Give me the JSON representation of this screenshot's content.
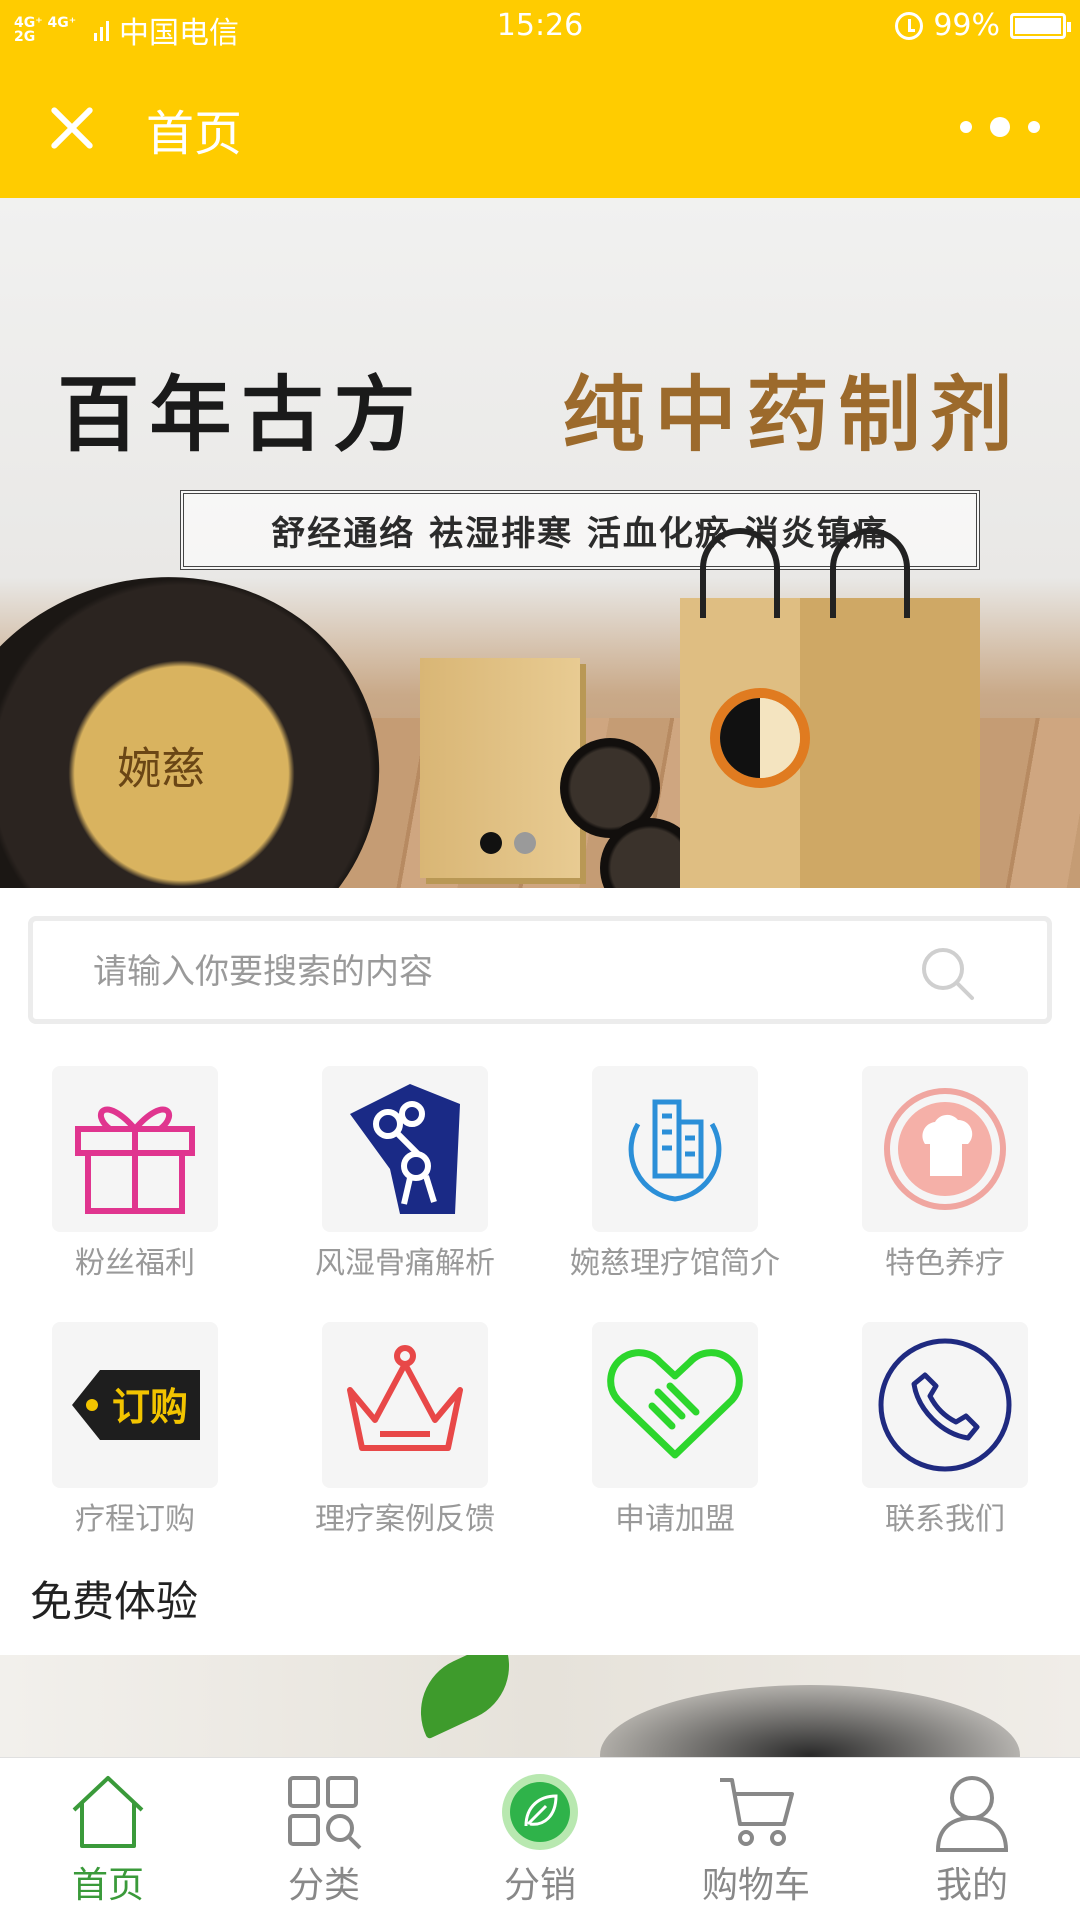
{
  "status_bar": {
    "network": "4G⁺ 4G⁺ 2G",
    "carrier": "中国电信",
    "time": "15:26",
    "battery": "99%",
    "battery_level": 0.99,
    "icons": [
      "signal-icon",
      "alarm-icon",
      "battery-icon"
    ]
  },
  "nav": {
    "title": "首页",
    "left_icon": "close-icon",
    "right_icon": "more-dots-icon"
  },
  "banner": {
    "headline_left": "百年古方",
    "headline_right": "纯中药制剂",
    "subline": "舒经通络 祛湿排寒 活血化瘀 消炎镇痛",
    "jar_brand": "婉慈",
    "slide_count": 2,
    "active_slide": 1,
    "colors": {
      "dot_active": "#111111",
      "dot_inactive": "#9a9a9a"
    }
  },
  "search": {
    "placeholder": "请输入你要搜索的内容",
    "value": "",
    "icon": "search-icon"
  },
  "grid": {
    "items": [
      {
        "label": "粉丝福利",
        "icon": "gift-icon",
        "color": "#e0358f"
      },
      {
        "label": "风湿骨痛解析",
        "icon": "bone-joint-icon",
        "color": "#1a2a86"
      },
      {
        "label": "婉慈理疗馆简介",
        "icon": "building-icon",
        "color": "#2b8fd8"
      },
      {
        "label": "特色养疗",
        "icon": "chef-hat-icon",
        "color": "#f0a6a0"
      },
      {
        "label": "疗程订购",
        "icon": "order-tag-icon",
        "color": "#f2c400"
      },
      {
        "label": "理疗案例反馈",
        "icon": "crown-icon",
        "color": "#e84848"
      },
      {
        "label": "申请加盟",
        "icon": "handshake-heart-icon",
        "color": "#2cd62c"
      },
      {
        "label": "联系我们",
        "icon": "phone-icon",
        "color": "#1f2a80"
      }
    ],
    "order_badge": "订购"
  },
  "section": {
    "title": "免费体验"
  },
  "tabbar": {
    "items": [
      {
        "label": "首页",
        "icon": "home-icon",
        "active": true
      },
      {
        "label": "分类",
        "icon": "category-search-icon",
        "active": false
      },
      {
        "label": "分销",
        "icon": "leaf-distribution-icon",
        "active": false
      },
      {
        "label": "购物车",
        "icon": "cart-icon",
        "active": false
      },
      {
        "label": "我的",
        "icon": "user-icon",
        "active": false
      }
    ],
    "colors": {
      "active": "#3a9a3a",
      "inactive": "#888888"
    }
  }
}
